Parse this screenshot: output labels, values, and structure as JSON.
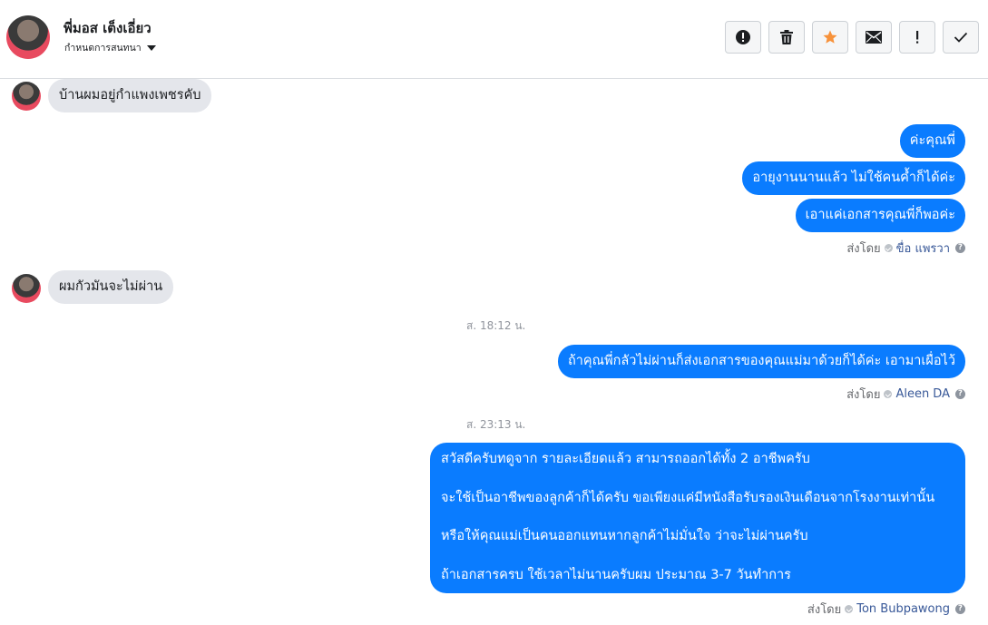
{
  "header": {
    "contact_name": "พี่มอส เต็งเอี่ยว",
    "assign_label": "กำหนดการสนทนา",
    "toolbar": [
      {
        "name": "report-button",
        "icon": "alert-circle-icon"
      },
      {
        "name": "delete-button",
        "icon": "trash-icon"
      },
      {
        "name": "star-button",
        "icon": "star-icon",
        "color": "#f7923b"
      },
      {
        "name": "mark-unread-button",
        "icon": "envelope-icon"
      },
      {
        "name": "mark-important-button",
        "icon": "exclamation-icon"
      },
      {
        "name": "mark-done-button",
        "icon": "checkmark-icon"
      }
    ]
  },
  "messages": {
    "m1": "บ้านผมอยู่กำแพงเพชรคับ",
    "m2": "ค่ะคุณพี่",
    "m3": "อายุงานนานแล้ว ไม่ใช้คนค้ำก็ได้ค่ะ",
    "m4": "เอาแค่เอกสารคุณพี่ก็พอค่ะ",
    "sent1_prefix": "ส่งโดย",
    "sent1_name": "ขื่อ แพรวา",
    "m5": "ผมกัวมันจะไม่ผ่าน",
    "time1": "ส. 18:12 น.",
    "m6": "ถ้าคุณพี่กลัวไม่ผ่านก็ส่งเอกสารของคุณแม่มาด้วยก็ได้ค่ะ เอามาเผื่อไว้",
    "sent2_prefix": "ส่งโดย",
    "sent2_name": "Aleen DA",
    "time2": "ส. 23:13 น.",
    "m7_lines": [
      "สวัสดีครับทดูจาก รายละเอียดแล้ว สามารถออกได้ทั้ง 2 อาชีพครับ",
      "จะใช้เป็นอาชีพของลูกค้าก็ได้ครับ ขอเพียงแค่มีหนังสือรับรองเงินเดือนจากโรงงานเท่านั้น",
      "หรือให้คุณแม่เป็นคนออกแทนหากลูกค้าไม่มั่นใจ ว่าจะไม่ผ่านครับ",
      "ถ้าเอกสารครบ ใช้เวลาไม่นานครับผม ประมาณ 3-7 วันทำการ"
    ],
    "sent3_prefix": "ส่งโดย",
    "sent3_name": "Ton Bubpawong"
  },
  "colors": {
    "outgoing_bubble": "#0a7cff",
    "incoming_bubble": "#e4e6eb"
  }
}
